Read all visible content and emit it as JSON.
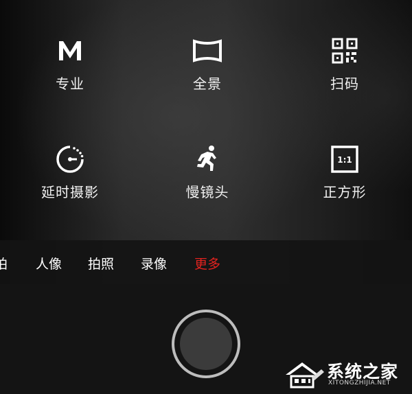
{
  "modes": {
    "professional": {
      "label": "专业",
      "icon": "m-letter-icon"
    },
    "panorama": {
      "label": "全景",
      "icon": "panorama-icon"
    },
    "scan": {
      "label": "扫码",
      "icon": "qr-code-icon"
    },
    "timelapse": {
      "label": "延时摄影",
      "icon": "timer-icon"
    },
    "slowmo": {
      "label": "慢镜头",
      "icon": "running-person-icon"
    },
    "square": {
      "label": "正方形",
      "icon": "square-ratio-icon",
      "icon_text": "1:1"
    }
  },
  "mode_strip": {
    "items": [
      {
        "label": "拍"
      },
      {
        "label": "人像"
      },
      {
        "label": "拍照"
      },
      {
        "label": "录像"
      },
      {
        "label": "更多"
      }
    ],
    "active_index": 4,
    "active_color": "#e3231f"
  },
  "shutter": {
    "icon": "shutter-button"
  },
  "watermark": {
    "text": "系统之家",
    "url": "XITONGZHIJIA.NET"
  }
}
